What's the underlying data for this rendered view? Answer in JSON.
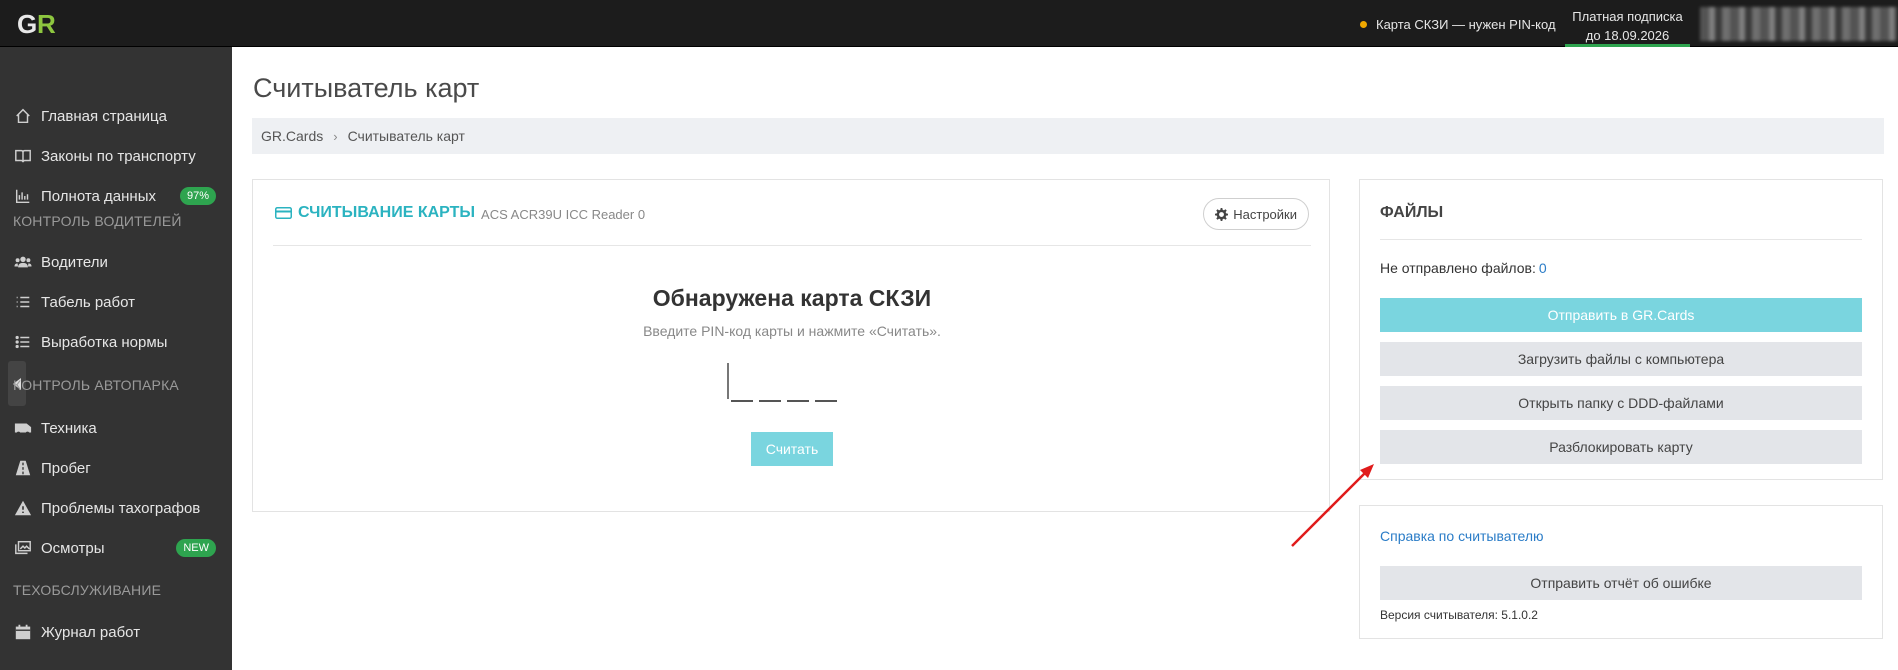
{
  "topbar": {
    "logo_text": "GR",
    "card_status": "Карта СКЗИ — нужен PIN-код",
    "subscription_line1": "Платная подписка",
    "subscription_line2": "до 18.09.2026"
  },
  "sidebar": {
    "items": [
      {
        "label": "Главная страница",
        "icon": "home-icon"
      },
      {
        "label": "Законы по транспорту",
        "icon": "book-icon"
      },
      {
        "label": "Полнота данных",
        "icon": "chart-icon",
        "badge": "97%"
      },
      {
        "label": "Водители",
        "icon": "users-icon"
      },
      {
        "label": "Табель работ",
        "icon": "list-icon"
      },
      {
        "label": "Выработка нормы",
        "icon": "list-dots-icon"
      },
      {
        "label": "Техника",
        "icon": "bus-icon"
      },
      {
        "label": "Пробег",
        "icon": "road-icon"
      },
      {
        "label": "Проблемы тахографов",
        "icon": "warning-icon"
      },
      {
        "label": "Осмотры",
        "icon": "photos-icon",
        "badge": "NEW"
      },
      {
        "label": "Журнал работ",
        "icon": "calendar-icon"
      }
    ],
    "sections": [
      "Контроль водителей",
      "Контроль автопарка",
      "Техобслуживание"
    ]
  },
  "main": {
    "page_title": "Считыватель карт",
    "breadcrumb": [
      "GR.Cards",
      "Считыватель карт"
    ],
    "reader": {
      "heading": "Считывание карты",
      "device": "ACS ACR39U ICC Reader 0",
      "settings_label": "Настройки",
      "detected_title": "Обнаружена карта СКЗИ",
      "pin_hint": "Введите PIN-код карты и нажмите «Считать».",
      "read_label": "Считать"
    },
    "files": {
      "title": "Файлы",
      "unsent_label": "Не отправлено файлов:",
      "unsent_count": "0",
      "send_label": "Отправить в GR.Cards",
      "upload_label": "Загрузить файлы с компьютера",
      "open_folder_label": "Открыть папку с DDD-файлами",
      "unlock_label": "Разблокировать карту"
    },
    "help": {
      "link_label": "Справка по считывателю",
      "report_label": "Отправить отчёт об ошибке",
      "version": "Версия считывателя: 5.1.0.2"
    }
  },
  "colors": {
    "accent": "#2bb3c0",
    "button_primary": "#7ad5df",
    "badge_green": "#2ea44f",
    "status_dot": "#f0a800",
    "sidebar_bg": "#333333",
    "topbar_bg": "#1c1c1c"
  }
}
